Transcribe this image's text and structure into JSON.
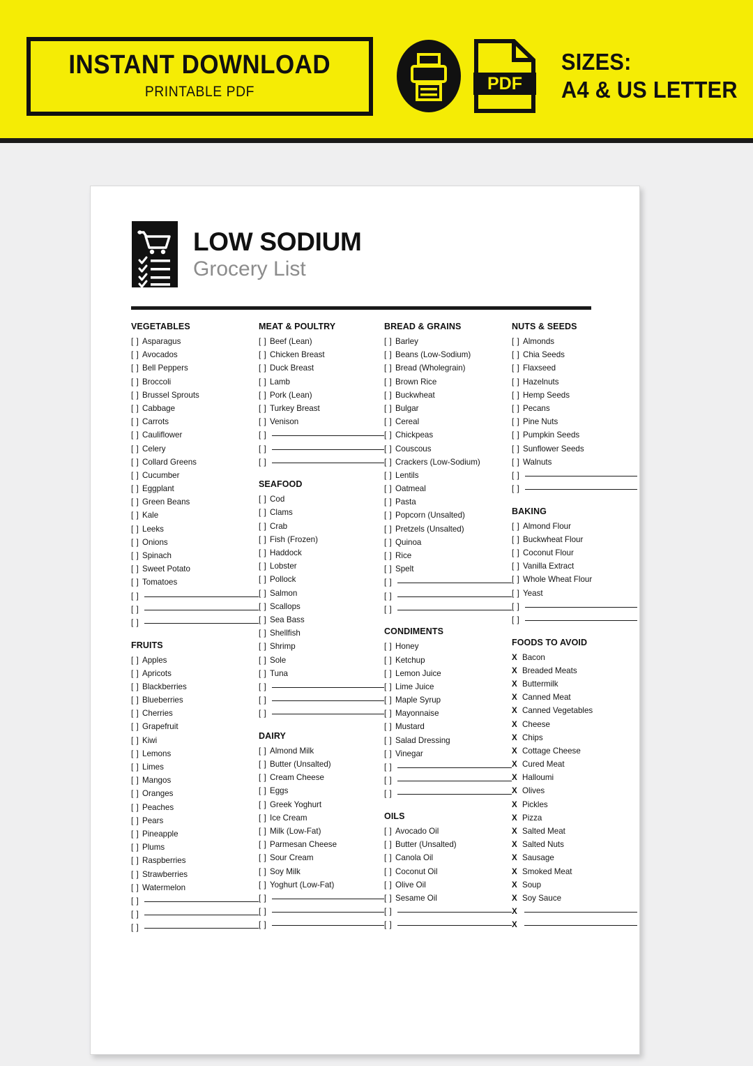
{
  "promo": {
    "title": "INSTANT DOWNLOAD",
    "subtitle": "PRINTABLE PDF",
    "pdf_label": "PDF",
    "sizes_line1": "SIZES:",
    "sizes_line2": "A4 & US LETTER",
    "printer_icon": "printer-icon",
    "pdf_icon": "pdf-file-icon",
    "background_color": "#f5ec05",
    "ink_color": "#111111"
  },
  "document": {
    "icon": "shopping-cart-checklist-icon",
    "title": "LOW SODIUM",
    "subtitle": "Grocery List",
    "checkbox_glyph": "[  ]",
    "avoid_glyph": "X",
    "columns": [
      {
        "sections": [
          {
            "title": "VEGETABLES",
            "marker": "checkbox",
            "items": [
              "Asparagus",
              "Avocados",
              "Bell Peppers",
              "Broccoli",
              "Brussel Sprouts",
              "Cabbage",
              "Carrots",
              "Cauliflower",
              "Celery",
              "Collard Greens",
              "Cucumber",
              "Eggplant",
              "Green Beans",
              "Kale",
              "Leeks",
              "Onions",
              "Spinach",
              "Sweet Potato",
              "Tomatoes"
            ],
            "blank_lines": 3
          },
          {
            "title": "FRUITS",
            "marker": "checkbox",
            "items": [
              "Apples",
              "Apricots",
              "Blackberries",
              "Blueberries",
              "Cherries",
              "Grapefruit",
              "Kiwi",
              "Lemons",
              "Limes",
              "Mangos",
              "Oranges",
              "Peaches",
              "Pears",
              "Pineapple",
              "Plums",
              "Raspberries",
              "Strawberries",
              "Watermelon"
            ],
            "blank_lines": 3
          }
        ]
      },
      {
        "sections": [
          {
            "title": "MEAT & POULTRY",
            "marker": "checkbox",
            "items": [
              "Beef (Lean)",
              "Chicken Breast",
              "Duck Breast",
              "Lamb",
              "Pork (Lean)",
              "Turkey Breast",
              "Venison"
            ],
            "blank_lines": 3
          },
          {
            "title": "SEAFOOD",
            "marker": "checkbox",
            "items": [
              "Cod",
              "Clams",
              "Crab",
              "Fish (Frozen)",
              "Haddock",
              "Lobster",
              "Pollock",
              "Salmon",
              "Scallops",
              "Sea Bass",
              "Shellfish",
              "Shrimp",
              "Sole",
              "Tuna"
            ],
            "blank_lines": 3
          },
          {
            "title": "DAIRY",
            "marker": "checkbox",
            "items": [
              "Almond Milk",
              "Butter (Unsalted)",
              "Cream Cheese",
              "Eggs",
              "Greek Yoghurt",
              "Ice Cream",
              "Milk (Low-Fat)",
              "Parmesan Cheese",
              "Sour Cream",
              "Soy Milk",
              "Yoghurt (Low-Fat)"
            ],
            "blank_lines": 3
          }
        ]
      },
      {
        "sections": [
          {
            "title": "BREAD & GRAINS",
            "marker": "checkbox",
            "items": [
              "Barley",
              "Beans (Low-Sodium)",
              "Bread (Wholegrain)",
              "Brown Rice",
              "Buckwheat",
              "Bulgar",
              "Cereal",
              "Chickpeas",
              "Couscous",
              "Crackers (Low-Sodium)",
              "Lentils",
              "Oatmeal",
              "Pasta",
              "Popcorn (Unsalted)",
              "Pretzels (Unsalted)",
              "Quinoa",
              "Rice",
              "Spelt"
            ],
            "blank_lines": 3
          },
          {
            "title": "CONDIMENTS",
            "marker": "checkbox",
            "items": [
              "Honey",
              "Ketchup",
              "Lemon Juice",
              "Lime Juice",
              "Maple Syrup",
              "Mayonnaise",
              "Mustard",
              "Salad Dressing",
              "Vinegar"
            ],
            "blank_lines": 3
          },
          {
            "title": "OILS",
            "marker": "checkbox",
            "items": [
              "Avocado Oil",
              "Butter (Unsalted)",
              "Canola Oil",
              "Coconut Oil",
              "Olive Oil",
              "Sesame Oil"
            ],
            "blank_lines": 2
          }
        ]
      },
      {
        "sections": [
          {
            "title": "NUTS & SEEDS",
            "marker": "checkbox",
            "items": [
              "Almonds",
              "Chia Seeds",
              "Flaxseed",
              "Hazelnuts",
              "Hemp Seeds",
              "Pecans",
              "Pine Nuts",
              "Pumpkin Seeds",
              "Sunflower Seeds",
              "Walnuts"
            ],
            "blank_lines": 2
          },
          {
            "title": "BAKING",
            "marker": "checkbox",
            "items": [
              "Almond Flour",
              "Buckwheat Flour",
              "Coconut Flour",
              "Vanilla Extract",
              "Whole Wheat Flour",
              "Yeast"
            ],
            "blank_lines": 2
          },
          {
            "title": "FOODS TO AVOID",
            "marker": "avoid",
            "items": [
              "Bacon",
              "Breaded Meats",
              "Buttermilk",
              "Canned Meat",
              "Canned Vegetables",
              "Cheese",
              "Chips",
              "Cottage Cheese",
              "Cured Meat",
              "Halloumi",
              "Olives",
              "Pickles",
              "Pizza",
              "Salted Meat",
              "Salted Nuts",
              "Sausage",
              "Smoked Meat",
              "Soup",
              "Soy Sauce"
            ],
            "blank_lines": 2
          }
        ]
      }
    ]
  }
}
